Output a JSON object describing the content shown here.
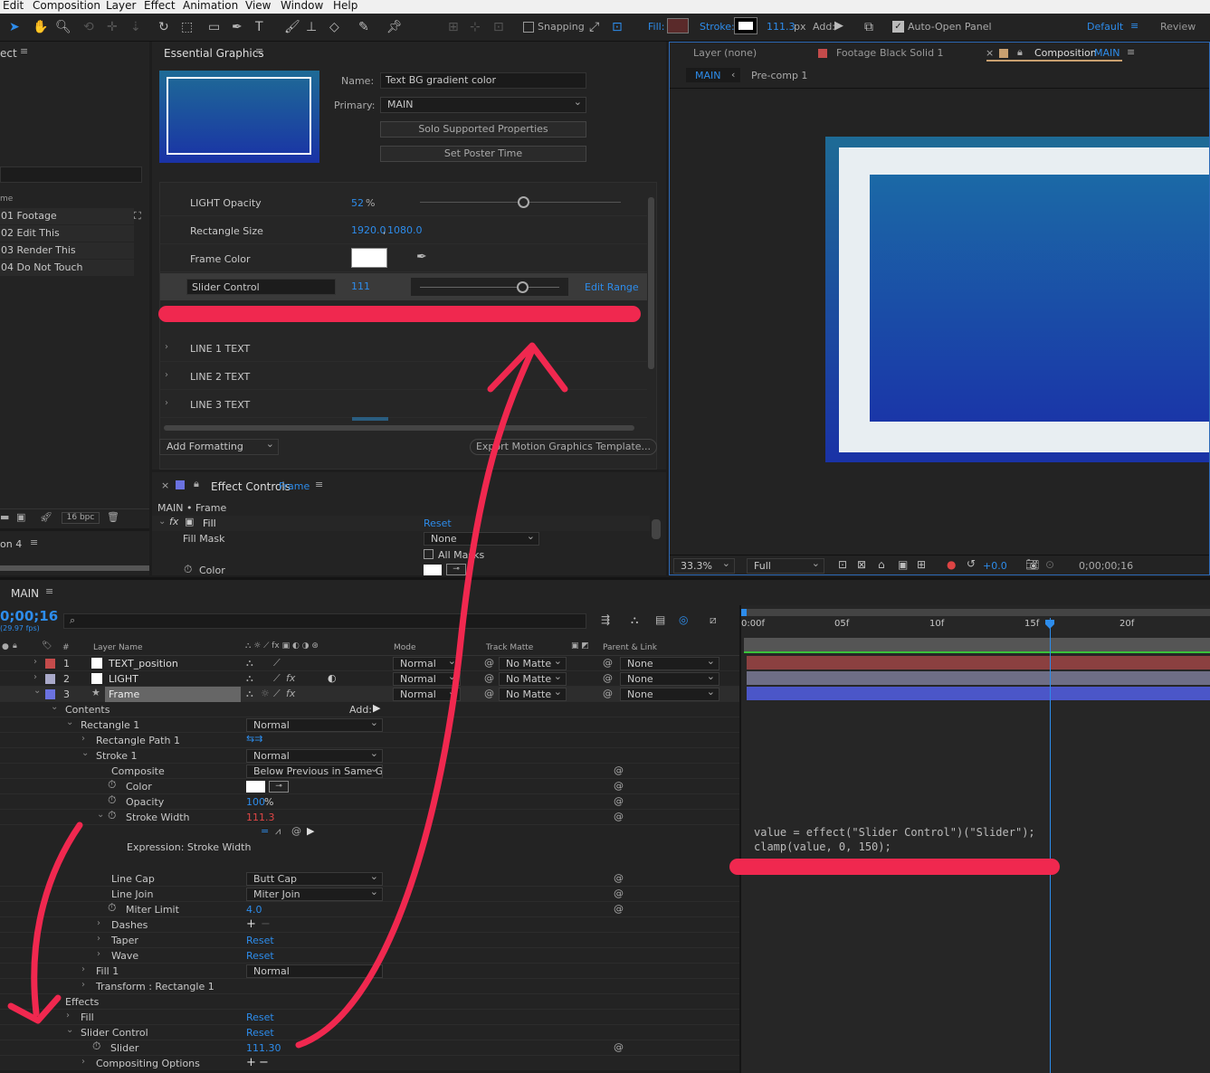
{
  "menu": [
    "Edit",
    "Composition",
    "Layer",
    "Effect",
    "View",
    "Animation",
    "Window",
    "Help"
  ],
  "toolbar": {
    "snapping": "Snapping",
    "fill": "Fill:",
    "stroke": "Stroke:",
    "stroke_px": "111.3",
    "px": "px",
    "add": "Add:",
    "auto_open": "Auto-Open Panel",
    "ws_default": "Default",
    "ws_review": "Review"
  },
  "project": {
    "title": "ect",
    "items": [
      "01 Footage",
      "02 Edit This",
      "03 Render This",
      "04 Do Not Touch"
    ],
    "col": "me",
    "bpc": "16 bpc",
    "render_tab": "on 4"
  },
  "eg": {
    "title": "Essential Graphics",
    "name_label": "Name:",
    "name_value": "Text BG gradient color",
    "primary_label": "Primary:",
    "primary_value": "MAIN",
    "solo_btn": "Solo Supported Properties",
    "poster_btn": "Set Poster Time",
    "light_label": "LIGHT Opacity",
    "light_value": "52",
    "light_unit": "%",
    "light_level": 0.52,
    "rect_label": "Rectangle Size",
    "rect_w": "1920.0",
    "rect_h": "1080.0",
    "rect_sep": ",",
    "frame_label": "Frame Color",
    "frame_color": "#ffffff",
    "slider_label": "Slider Control",
    "slider_value": "111",
    "edit_range": "Edit Range",
    "slider_level": 0.74,
    "groups": [
      "LINE 1 TEXT",
      "LINE 2 TEXT",
      "LINE 3 TEXT"
    ],
    "add_formatting": "Add Formatting",
    "export_btn": "Export Motion Graphics Template..."
  },
  "ec": {
    "title": "Effect Controls",
    "layer": "Frame",
    "path": "MAIN • Frame",
    "fill": "Fill",
    "reset": "Reset",
    "fill_mask": "Fill Mask",
    "fill_mask_value": "None",
    "all_masks": "All Masks",
    "color": "Color"
  },
  "viewer": {
    "tab_layer": "Layer (none)",
    "tab_footage_pre": "Footage",
    "tab_footage": "Black Solid 1",
    "tab_comp_pre": "Composition",
    "tab_comp": "MAIN",
    "crumb_main": "MAIN",
    "crumb_pre": "Pre-comp 1",
    "zoom": "33.3%",
    "quality": "Full",
    "exposure": "+0.0",
    "timecode": "0;00;00;16"
  },
  "timeline": {
    "title": "MAIN",
    "timecode": "0;00;16",
    "fps": "(29.97 fps)",
    "ruler": [
      "0:00f",
      "05f",
      "10f",
      "15f",
      "20f"
    ],
    "cols": {
      "num": "#",
      "name": "Layer Name",
      "mode": "Mode",
      "matte": "Track Matte",
      "parent": "Parent & Link"
    },
    "layers": [
      {
        "num": "1",
        "name": "TEXT_position",
        "color": "#c44b4b",
        "mode": "Normal",
        "matte": "No Matte",
        "parent": "None",
        "bar": "#8b4040"
      },
      {
        "num": "2",
        "name": "LIGHT",
        "color": "#a9a9c9",
        "mode": "Normal",
        "matte": "No Matte",
        "parent": "None",
        "bar": "#6e6e86"
      },
      {
        "num": "3",
        "name": "Frame",
        "color": "#6b72e0",
        "mode": "Normal",
        "matte": "No Matte",
        "parent": "None",
        "bar": "#4b56c8"
      }
    ],
    "props": {
      "contents": "Contents",
      "add": "Add:",
      "rect1": "Rectangle 1",
      "rect_mode": "Normal",
      "rect_path": "Rectangle Path 1",
      "stroke1": "Stroke 1",
      "stroke_mode": "Normal",
      "composite": "Composite",
      "composite_value": "Below Previous in Same Group",
      "color": "Color",
      "opacity": "Opacity",
      "opacity_value": "100",
      "opacity_unit": "%",
      "stroke_width": "Stroke Width",
      "stroke_width_value": "111.3",
      "expr_label": "Expression: Stroke Width",
      "line_cap": "Line Cap",
      "line_cap_value": "Butt Cap",
      "line_join": "Line Join",
      "line_join_value": "Miter Join",
      "miter": "Miter Limit",
      "miter_value": "4.0",
      "dashes": "Dashes",
      "taper": "Taper",
      "wave": "Wave",
      "reset": "Reset",
      "fill1": "Fill 1",
      "fill_mode": "Normal",
      "transform": "Transform : Rectangle 1",
      "effects": "Effects",
      "fill": "Fill",
      "slider_control": "Slider Control",
      "slider": "Slider",
      "slider_value": "111.30",
      "compositing": "Compositing Options"
    },
    "expression": [
      "value = effect(\"Slider Control\")(\"Slider\");",
      "clamp(value, 0, 150);"
    ]
  },
  "colors": {
    "accent": "#2d8ceb",
    "annotation": "#f0284f",
    "gradient_top": "#1e6b96",
    "gradient_bottom": "#1a32a6"
  }
}
